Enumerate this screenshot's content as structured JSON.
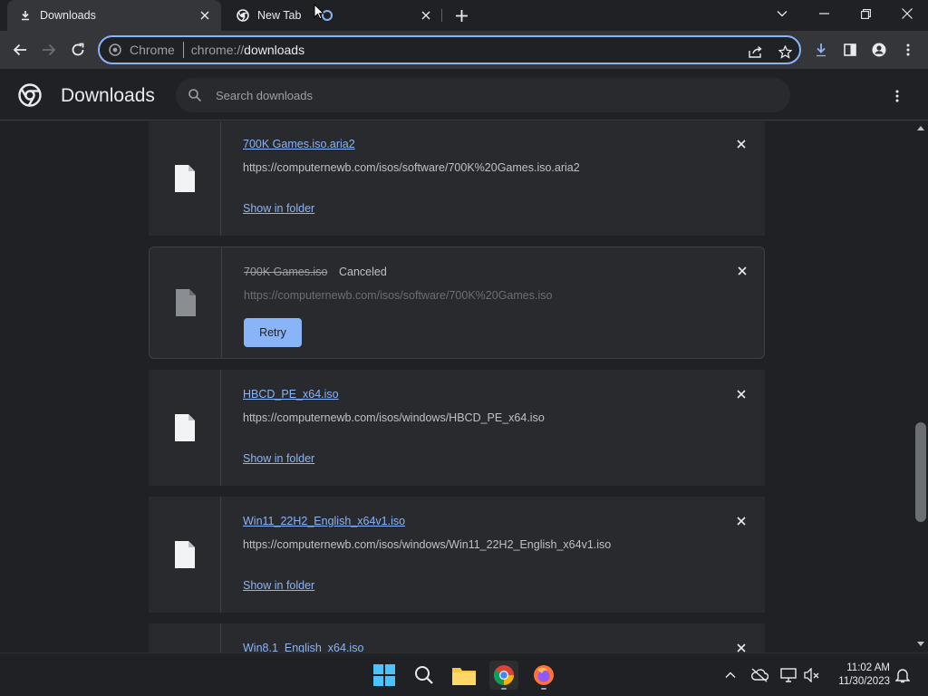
{
  "tabs": [
    {
      "title": "Downloads",
      "icon": "download-icon"
    },
    {
      "title": "New Tab",
      "icon": "chrome-icon"
    }
  ],
  "address_bar": {
    "chip": "Chrome",
    "scheme": "chrome://",
    "host": "downloads"
  },
  "page": {
    "title": "Downloads",
    "search_placeholder": "Search downloads"
  },
  "downloads": [
    {
      "name": "700K Games.iso.aria2",
      "url": "https://computernewb.com/isos/software/700K%20Games.iso.aria2",
      "action": "Show in folder"
    },
    {
      "name": "700K Games.iso",
      "status": "Canceled",
      "url": "https://computernewb.com/isos/software/700K%20Games.iso",
      "action": "Retry"
    },
    {
      "name": "HBCD_PE_x64.iso",
      "url": "https://computernewb.com/isos/windows/HBCD_PE_x64.iso",
      "action": "Show in folder"
    },
    {
      "name": "Win11_22H2_English_x64v1.iso",
      "url": "https://computernewb.com/isos/windows/Win11_22H2_English_x64v1.iso",
      "action": "Show in folder"
    },
    {
      "name": "Win8.1_English_x64.iso"
    }
  ],
  "clock": {
    "time": "11:02 AM",
    "date": "11/30/2023"
  },
  "colors": {
    "accent": "#8ab4f8",
    "background": "#202124",
    "card": "#292a2d"
  }
}
